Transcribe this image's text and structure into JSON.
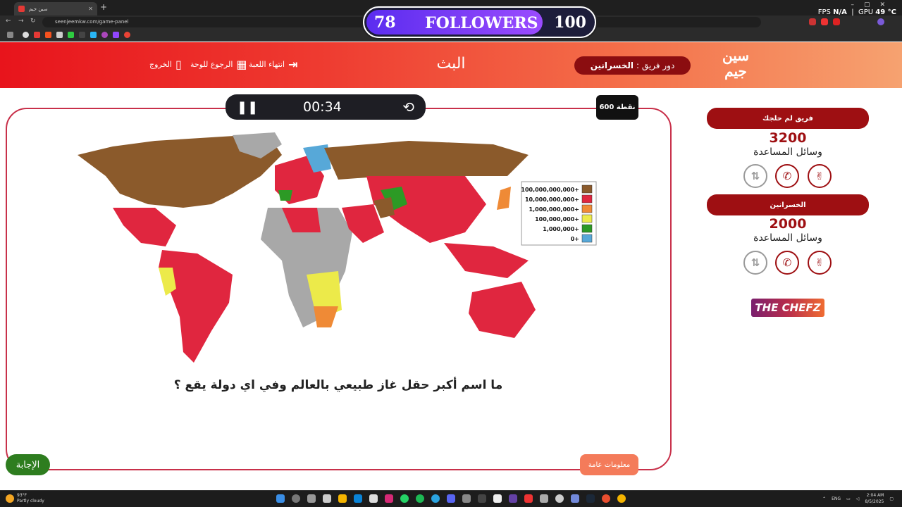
{
  "browser": {
    "tab_title": "سين جيم",
    "url": "seenjeemkw.com/game-panel"
  },
  "overlay": {
    "followers_current": "78",
    "followers_label": "FOLLOWERS",
    "followers_goal": "100",
    "followers_progress": 0.78,
    "fps_label": "FPS",
    "fps_value": "N/A",
    "gpu_label": "GPU",
    "gpu_value": "49 °C"
  },
  "header": {
    "logo_text_1": "سين",
    "logo_text_2": "جيم",
    "turn_prefix": "دور فريق :",
    "turn_team": "الخسرانين",
    "live_label": "البث",
    "end_game": "انتهاء اللعبة",
    "back_to_board": "الرجوع للوحة",
    "exit": "الخروج"
  },
  "question_panel": {
    "timer": "00:34",
    "points": "600 نقطة",
    "question": "ما اسم أكبر حقل غاز طبيعي بالعالم وفي اي دولة يقع ؟",
    "answer_button": "الإجابة",
    "category_button": "معلومات عامة"
  },
  "map_legend": {
    "entries": [
      {
        "label": "100,000,000,000+",
        "color": "#8b5a2b"
      },
      {
        "label": "10,000,000,000+",
        "color": "#e0263f"
      },
      {
        "label": "1,000,000,000+",
        "color": "#ef8a36"
      },
      {
        "label": "100,000,000+",
        "color": "#ecea4a"
      },
      {
        "label": "1,000,000+",
        "color": "#2c9a25"
      },
      {
        "label": "0+",
        "color": "#57a8d8"
      }
    ]
  },
  "teams": [
    {
      "name": "فريق لم حلجك",
      "score": "3200",
      "aids_label": "وسائل المساعدة"
    },
    {
      "name": "الخسرانين",
      "score": "2000",
      "aids_label": "وسائل المساعدة"
    }
  ],
  "sponsor": "THE CHEFZ",
  "taskbar": {
    "temp": "93°F",
    "weather": "Partly cloudy",
    "lang": "ENG",
    "time": "2:04 AM",
    "date": "8/5/2025"
  },
  "colors": {
    "accent_dark_red": "#9e0f12",
    "header_start": "#e8141c",
    "header_end": "#f6a270",
    "answer_green": "#2e7d1f"
  }
}
